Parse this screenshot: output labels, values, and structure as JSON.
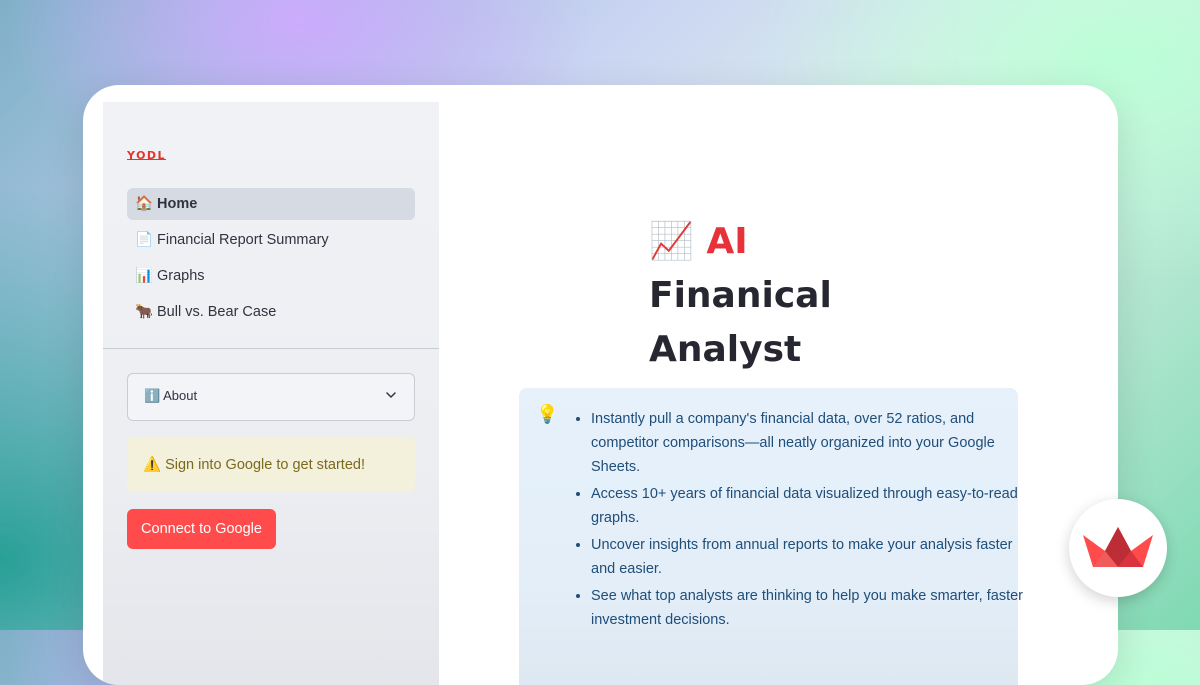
{
  "sidebar": {
    "logo_text": "YODL",
    "nav_items": [
      {
        "icon": "🏠",
        "label": "Home",
        "active": true
      },
      {
        "icon": "📄",
        "label": "Financial Report Summary",
        "active": false
      },
      {
        "icon": "📊",
        "label": "Graphs",
        "active": false
      },
      {
        "icon": "🐂",
        "label": "Bull vs. Bear Case",
        "active": false
      }
    ],
    "about_label": "ℹ️ About",
    "warning_text": "⚠️ Sign into Google to get started!",
    "connect_label": "Connect to Google"
  },
  "main": {
    "title_icon": "📈",
    "title_ai": "AI",
    "title_rest_1": "Finanical",
    "title_rest_2": "Analyst",
    "info_icon": "💡",
    "bullets": [
      "Instantly pull a company's financial data, over 52 ratios, and competitor comparisons—all neatly organized into your Google Sheets.",
      "Access 10+ years of financial data visualized through easy-to-read graphs.",
      "Uncover insights from annual reports to make your analysis faster and easier.",
      "See what top analysts are thinking to help you make smarter, faster investment decisions."
    ]
  },
  "colors": {
    "accent": "#ff4b4b",
    "title_ai": "#e8323a",
    "info_text": "#1f4e79",
    "warning_text": "#7a6a1e"
  },
  "icons": {
    "about_chevron": "chevron-down-icon",
    "badge": "streamlit-crown-icon"
  }
}
